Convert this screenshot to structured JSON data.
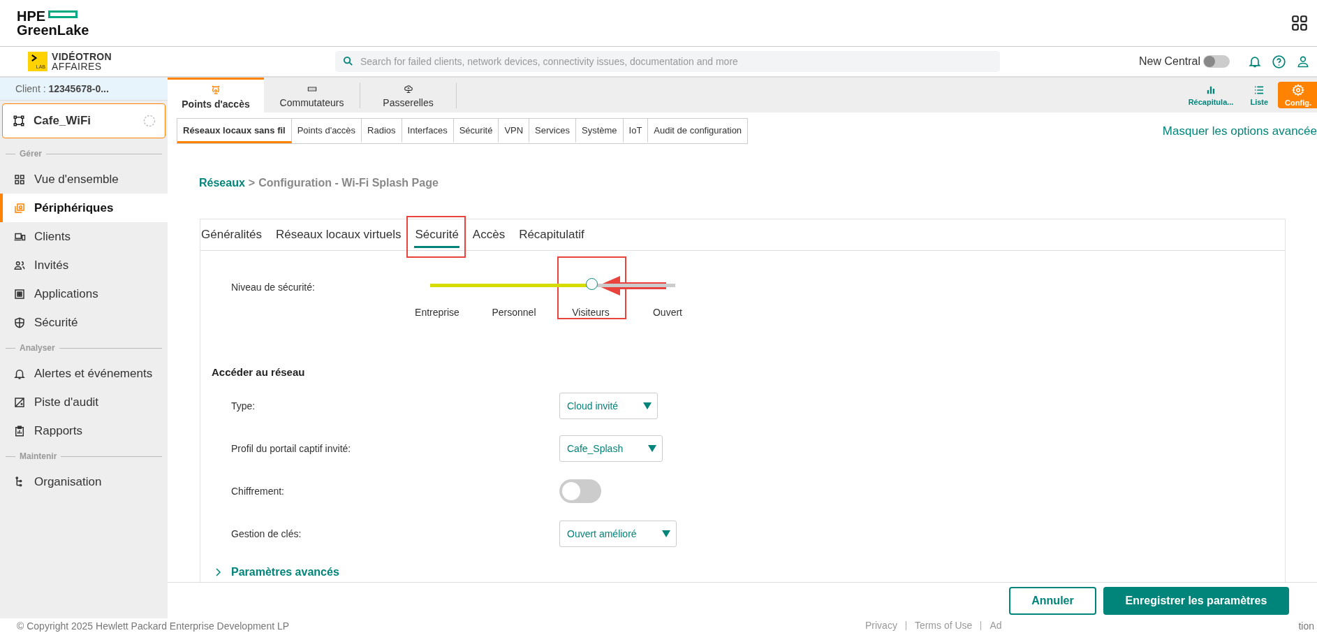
{
  "header": {
    "brand_line1": "HPE",
    "brand_line2": "GreenLake"
  },
  "topbar": {
    "logo_line1": "VIDÉOTRON",
    "logo_line2": "AFFAIRES",
    "logo_badge": "LAB",
    "search": {
      "placeholder": "Search for failed clients, network devices, connectivity issues, documentation and more"
    },
    "new_central": {
      "label": "New Central",
      "on": false
    }
  },
  "sidebar": {
    "client_label": "Client :",
    "client_value": "12345678-0...",
    "site": "Cafe_WiFi",
    "sections": [
      {
        "title": "Gérer",
        "items": [
          {
            "label": "Vue d'ensemble",
            "selected": false
          },
          {
            "label": "Périphériques",
            "selected": true
          },
          {
            "label": "Clients",
            "selected": false
          },
          {
            "label": "Invités",
            "selected": false
          },
          {
            "label": "Applications",
            "selected": false
          },
          {
            "label": "Sécurité",
            "selected": false
          }
        ]
      },
      {
        "title": "Analyser",
        "items": [
          {
            "label": "Alertes et événements",
            "selected": false
          },
          {
            "label": "Piste d'audit",
            "selected": false
          },
          {
            "label": "Rapports",
            "selected": false
          }
        ]
      },
      {
        "title": "Maintenir",
        "items": [
          {
            "label": "Organisation",
            "selected": false
          }
        ]
      }
    ]
  },
  "device_tabs": [
    {
      "label": "Points d'accès",
      "selected": true
    },
    {
      "label": "Commutateurs",
      "selected": false
    },
    {
      "label": "Passerelles",
      "selected": false
    }
  ],
  "view_buttons": [
    {
      "label": "Récapitula...",
      "selected": false
    },
    {
      "label": "Liste",
      "selected": false
    },
    {
      "label": "Config.",
      "selected": true
    }
  ],
  "config_tabs": [
    {
      "label": "Réseaux locaux sans fil",
      "selected": true
    },
    {
      "label": "Points d'accès",
      "selected": false
    },
    {
      "label": "Radios",
      "selected": false
    },
    {
      "label": "Interfaces",
      "selected": false
    },
    {
      "label": "Sécurité",
      "selected": false
    },
    {
      "label": "VPN",
      "selected": false
    },
    {
      "label": "Services",
      "selected": false
    },
    {
      "label": "Système",
      "selected": false
    },
    {
      "label": "IoT",
      "selected": false
    },
    {
      "label": "Audit de configuration",
      "selected": false
    }
  ],
  "advanced_link": "Masquer les options avancée",
  "breadcrumb": {
    "link": "Réseaux",
    "separator": ">",
    "current": "Configuration - Wi-Fi Splash Page"
  },
  "wizard_tabs": [
    {
      "label": "Généralités",
      "selected": false
    },
    {
      "label": "Réseaux locaux virtuels",
      "selected": false
    },
    {
      "label": "Sécurité",
      "selected": true
    },
    {
      "label": "Accès",
      "selected": false
    },
    {
      "label": "Récapitulatif",
      "selected": false
    }
  ],
  "security_level": {
    "label": "Niveau de sécurité:",
    "level": 0.66,
    "stops": [
      "Entreprise",
      "Personnel",
      "Visiteurs",
      "Ouvert"
    ]
  },
  "access": {
    "title": "Accéder au réseau",
    "fields": [
      {
        "kind": "select",
        "label": "Type:",
        "value": "Cloud invité"
      },
      {
        "kind": "select",
        "label": "Profil du portail captif invité:",
        "value": "Cafe_Splash"
      },
      {
        "kind": "toggle",
        "label": "Chiffrement:",
        "on": false
      },
      {
        "kind": "select",
        "label": "Gestion de clés:",
        "value": "Ouvert amélioré"
      }
    ]
  },
  "advanced": {
    "label": "Paramètres avancés",
    "expanded": false
  },
  "actions": {
    "cancel": "Annuler",
    "save": "Enregistrer les paramètres"
  },
  "footer": {
    "copyright": "© Copyright 2025 Hewlett Packard Enterprise Development LP",
    "links": [
      "Privacy",
      "Terms of Use",
      "Ad"
    ],
    "tail": "tion"
  }
}
